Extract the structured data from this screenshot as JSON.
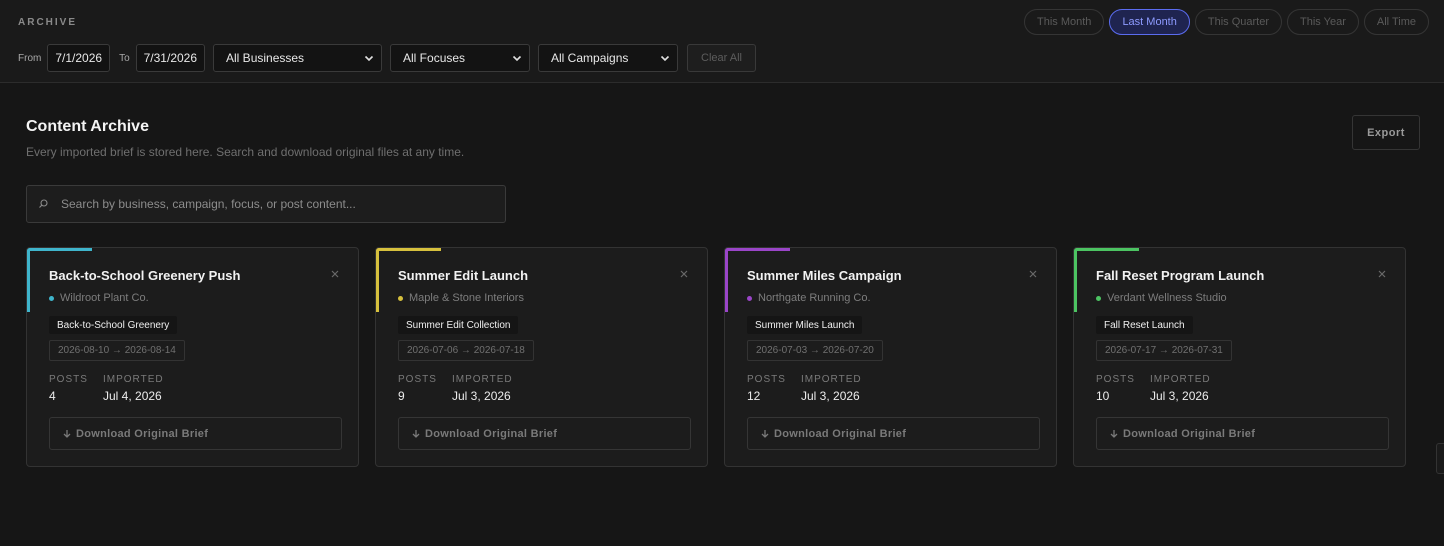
{
  "header": {
    "section_label": "ARCHIVE",
    "range_options": [
      "This Month",
      "Last Month",
      "This Quarter",
      "This Year",
      "All Time"
    ],
    "active_range": "Last Month"
  },
  "filters": {
    "from_label": "From",
    "from_value": "7/1/2026",
    "to_label": "To",
    "to_value": "7/31/2026",
    "business_select": "All Businesses",
    "focus_select": "All Focuses",
    "campaign_select": "All Campaigns",
    "clear_label": "Clear All"
  },
  "page": {
    "title": "Content Archive",
    "subtitle": "Every imported brief is stored here. Search and download original files at any time.",
    "export_label": "Export",
    "search_placeholder": "Search by business, campaign, focus, or post content..."
  },
  "cards": [
    {
      "title": "Back-to-School Greenery Push",
      "business": "Wildroot Plant Co.",
      "accent_color": "#3fb5cc",
      "campaign": "Back-to-School Greenery",
      "date_range": "2026-08-10 → 2026-08-14",
      "posts_label": "POSTS",
      "posts": "4",
      "imported_label": "IMPORTED",
      "imported": "Jul 4, 2026",
      "download_label": "Download Original Brief"
    },
    {
      "title": "Summer Edit Launch",
      "business": "Maple & Stone Interiors",
      "accent_color": "#d6c03d",
      "campaign": "Summer Edit Collection",
      "date_range": "2026-07-06 → 2026-07-18",
      "posts_label": "POSTS",
      "posts": "9",
      "imported_label": "IMPORTED",
      "imported": "Jul 3, 2026",
      "download_label": "Download Original Brief"
    },
    {
      "title": "Summer Miles Campaign",
      "business": "Northgate Running Co.",
      "accent_color": "#9a45c8",
      "campaign": "Summer Miles Launch",
      "date_range": "2026-07-03 → 2026-07-20",
      "posts_label": "POSTS",
      "posts": "12",
      "imported_label": "IMPORTED",
      "imported": "Jul 3, 2026",
      "download_label": "Download Original Brief"
    },
    {
      "title": "Fall Reset Program Launch",
      "business": "Verdant Wellness Studio",
      "accent_color": "#4cc462",
      "campaign": "Fall Reset Launch",
      "date_range": "2026-07-17 → 2026-07-31",
      "posts_label": "POSTS",
      "posts": "10",
      "imported_label": "IMPORTED",
      "imported": "Jul 3, 2026",
      "download_label": "Download Original Brief"
    }
  ],
  "icons": {
    "search": "search-icon",
    "close": "close-icon",
    "chevron": "chevron-down-icon",
    "download": "download-arrow-icon"
  }
}
